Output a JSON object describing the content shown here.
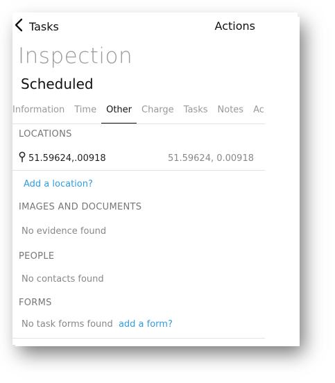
{
  "header": {
    "back_label": "Tasks",
    "actions_label": "Actions"
  },
  "task": {
    "title": "Inspection",
    "status": "Scheduled"
  },
  "tabs": [
    {
      "label": "Information"
    },
    {
      "label": "Time"
    },
    {
      "label": "Other"
    },
    {
      "label": "Charge"
    },
    {
      "label": "Tasks"
    },
    {
      "label": "Notes"
    },
    {
      "label": "Ac"
    }
  ],
  "active_tab": "Other",
  "locations": {
    "header": "LOCATIONS",
    "items": [
      {
        "name": "51.59624,.00918",
        "coords": "51.59624, 0.00918"
      }
    ],
    "add_link": "Add a location?"
  },
  "images": {
    "header": "IMAGES AND DOCUMENTS",
    "empty": "No evidence found"
  },
  "people": {
    "header": "PEOPLE",
    "empty": "No contacts found"
  },
  "forms": {
    "header": "FORMS",
    "empty": "No task forms found",
    "add_link": "add a form?"
  },
  "colors": {
    "link": "#2f9ee0",
    "muted": "#888888",
    "text": "#111111"
  }
}
